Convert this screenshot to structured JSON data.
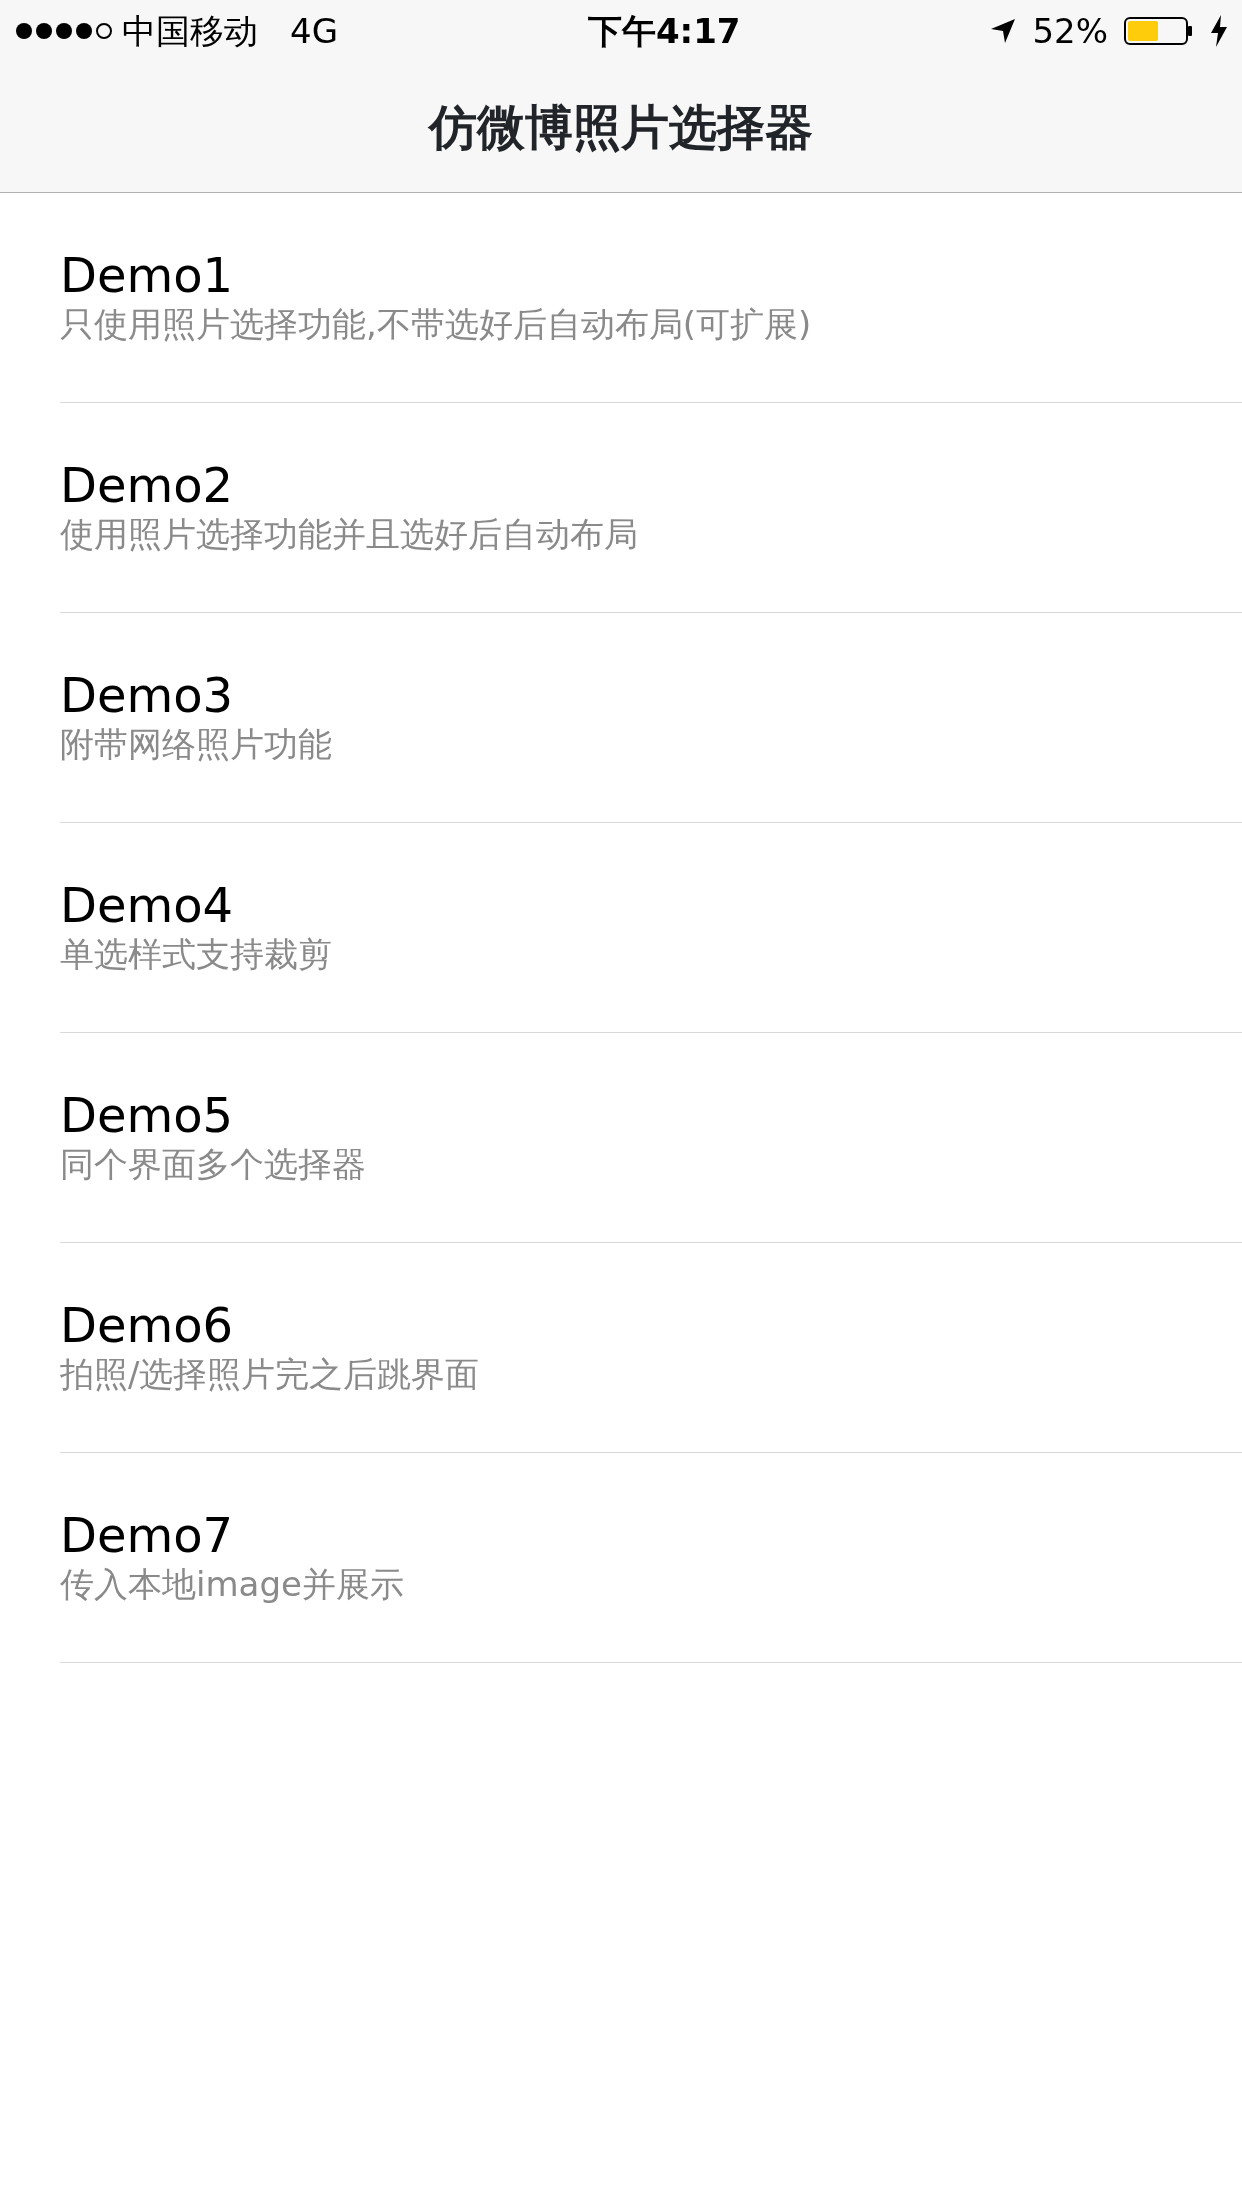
{
  "status_bar": {
    "carrier": "中国移动",
    "network": "4G",
    "time": "下午4:17",
    "battery": "52%"
  },
  "nav_bar": {
    "title": "仿微博照片选择器"
  },
  "items": [
    {
      "title": "Demo1",
      "subtitle": "只使用照片选择功能,不带选好后自动布局(可扩展)"
    },
    {
      "title": "Demo2",
      "subtitle": "使用照片选择功能并且选好后自动布局"
    },
    {
      "title": "Demo3",
      "subtitle": "附带网络照片功能"
    },
    {
      "title": "Demo4",
      "subtitle": "单选样式支持裁剪"
    },
    {
      "title": "Demo5",
      "subtitle": "同个界面多个选择器"
    },
    {
      "title": "Demo6",
      "subtitle": "拍照/选择照片完之后跳界面"
    },
    {
      "title": "Demo7",
      "subtitle": "传入本地image并展示"
    }
  ]
}
